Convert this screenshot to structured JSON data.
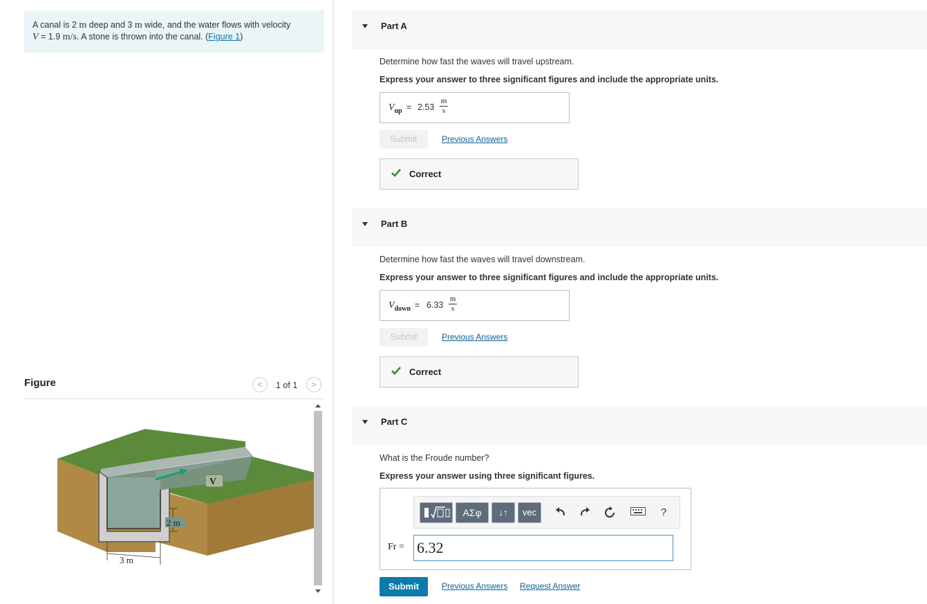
{
  "problem": {
    "t1": "A canal is 2 ",
    "u1": "m",
    "t2": " deep and 3 ",
    "u2": "m",
    "t3": " wide, and the water flows with velocity",
    "v": "V",
    "t4": " = 1.9 ",
    "u3": "m/s",
    "t5": ". A stone is thrown into the canal. (",
    "link": "Figure 1",
    "t6": ")"
  },
  "figure": {
    "title": "Figure",
    "counter": "1 of 1",
    "prev_icon": "<",
    "next_icon": ">",
    "labels": {
      "v": "V",
      "depth": "2 m",
      "width": "3 m"
    }
  },
  "partA": {
    "label": "Part A",
    "question": "Determine how fast the waves will travel upstream.",
    "instruction": "Express your answer to three significant figures and include the appropriate units.",
    "var_main": "V",
    "var_sub": "up",
    "eq": "=",
    "value": "2.53",
    "unit_num": "m",
    "unit_den": "s",
    "submit": "Submit",
    "prev_answers": "Previous Answers",
    "result": "Correct"
  },
  "partB": {
    "label": "Part B",
    "question": "Determine how fast the waves will travel downstream.",
    "instruction": "Express your answer to three significant figures and include the appropriate units.",
    "var_main": "V",
    "var_sub": "down",
    "eq": "=",
    "value": "6.33",
    "unit_num": "m",
    "unit_den": "s",
    "submit": "Submit",
    "prev_answers": "Previous Answers",
    "result": "Correct"
  },
  "partC": {
    "label": "Part C",
    "question": "What is the Froude number?",
    "instruction": "Express your answer using three significant figures.",
    "toolbar": {
      "greek": "ΑΣφ",
      "arrows": "↓↑",
      "vec": "vec",
      "help": "?"
    },
    "var_label": "Fr =",
    "value": "6.32",
    "submit": "Submit",
    "prev_answers": "Previous Answers",
    "request_answer": "Request Answer"
  },
  "colors": {
    "accent": "#0a7ca9",
    "link": "#0b5f92",
    "correct": "#2b8a3e",
    "problem_bg": "#e9f5f6"
  }
}
